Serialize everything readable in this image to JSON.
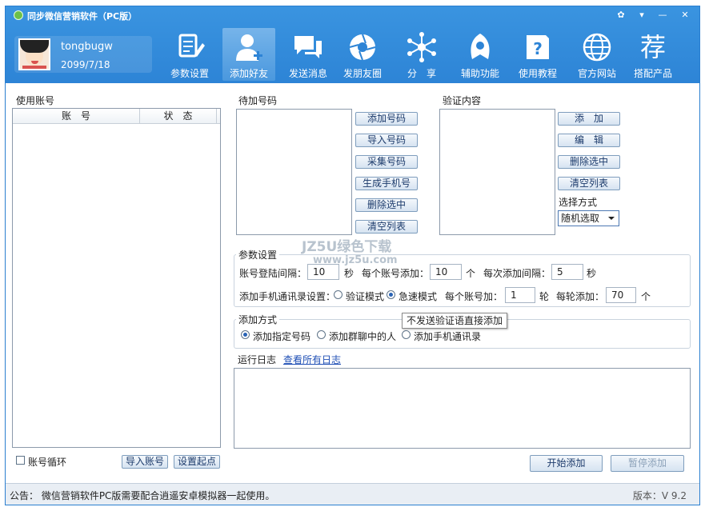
{
  "window": {
    "title": "同步微信营销软件（PC版）",
    "controls": [
      "skin-icon",
      "menu-icon",
      "minimize-icon",
      "close-icon"
    ]
  },
  "user": {
    "name": "tongbugw",
    "date": "2099/7/18"
  },
  "nav": [
    {
      "label": "参数设置",
      "icon": "settings-doc-icon"
    },
    {
      "label": "添加好友",
      "icon": "add-friend-icon",
      "active": true
    },
    {
      "label": "发送消息",
      "icon": "chat-bubbles-icon"
    },
    {
      "label": "发朋友圈",
      "icon": "camera-aperture-icon"
    },
    {
      "label": "分　享",
      "icon": "share-network-icon"
    },
    {
      "label": "辅助功能",
      "icon": "helper-icon"
    },
    {
      "label": "使用教程",
      "icon": "help-book-icon"
    },
    {
      "label": "官方网站",
      "icon": "globe-icon"
    },
    {
      "label": "搭配产品",
      "icon": "recommend-icon",
      "glyph": "荐"
    }
  ],
  "accounts": {
    "title": "使用账号",
    "columns": [
      "账　号",
      "状　态"
    ],
    "loop_label": "账号循环",
    "import_label": "导入账号",
    "set_start_label": "设置起点"
  },
  "pending": {
    "title": "待加号码",
    "buttons": [
      "添加号码",
      "导入号码",
      "采集号码",
      "生成手机号",
      "删除选中",
      "清空列表"
    ]
  },
  "verify": {
    "title": "验证内容",
    "buttons": [
      "添　加",
      "编　辑",
      "删除选中",
      "清空列表"
    ],
    "mode_label": "选择方式",
    "mode_value": "随机选取"
  },
  "params": {
    "legend": "参数设置",
    "login_interval_label": "账号登陆间隔：",
    "login_interval": "10",
    "sec1": "秒",
    "per_account_label": "每个账号添加：",
    "per_account": "10",
    "unit_ge1": "个",
    "add_interval_label": "每次添加间隔：",
    "add_interval": "5",
    "sec2": "秒",
    "contacts_setting_label": "添加手机通讯录设置：",
    "mode_verify": "验证模式",
    "mode_fast": "急速模式",
    "per_account_rounds_label": "每个账号加：",
    "rounds": "1",
    "unit_lun": "轮",
    "per_round_label": "每轮添加：",
    "per_round": "70",
    "unit_ge2": "个"
  },
  "add_method": {
    "legend": "添加方式",
    "opt1": "添加指定号码",
    "opt2": "添加群聊中的人",
    "opt3": "添加手机通讯录",
    "tooltip": "不发送验证语直接添加"
  },
  "log": {
    "title": "运行日志",
    "view_all": "查看所有日志"
  },
  "actions": {
    "start": "开始添加",
    "pause": "暂停添加"
  },
  "status": {
    "notice": "公告：  微信营销软件PC版需要配合逍遥安卓模拟器一起使用。",
    "version": "版本：V 9.2"
  },
  "watermark": {
    "line1": "JZ5U绿色下载",
    "line2": "www.jz5u.com"
  },
  "colors": {
    "header": "#2d84d6",
    "active_tab": "#5aa4e4",
    "button_text": "#1b3a6b",
    "link": "#1f4fb5"
  }
}
